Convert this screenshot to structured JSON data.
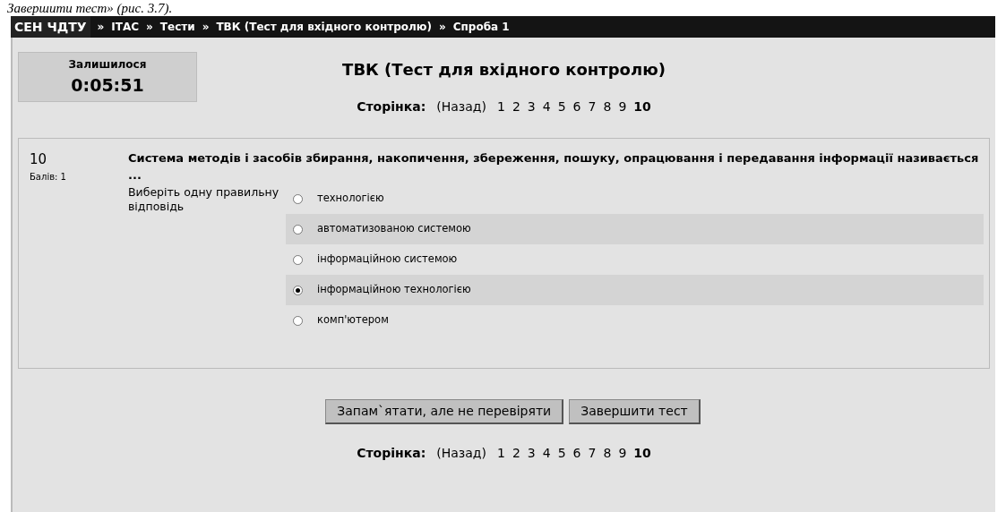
{
  "document_text": "Завершити тест» (рис. 3.7).",
  "breadcrumb": [
    {
      "label": "СЕН ЧДТУ",
      "kind": "home"
    },
    {
      "label": "ІТАС",
      "kind": "link"
    },
    {
      "label": "Тести",
      "kind": "link"
    },
    {
      "label": "ТВК (Тест для вхідного контролю)",
      "kind": "link"
    },
    {
      "label": "Спроба 1",
      "kind": "link"
    }
  ],
  "breadcrumb_separator": "»",
  "timer": {
    "label": "Залишилося",
    "value": "0:05:51"
  },
  "title": "ТВК (Тест для вхідного контролю)",
  "pager_top": {
    "label": "Сторінка:",
    "previous": "(Назад)",
    "pages": [
      {
        "label": "1",
        "selected": false
      },
      {
        "label": "2",
        "selected": false
      },
      {
        "label": "3",
        "selected": false
      },
      {
        "label": "4",
        "selected": false
      },
      {
        "label": "5",
        "selected": false
      },
      {
        "label": "6",
        "selected": false
      },
      {
        "label": "7",
        "selected": false
      },
      {
        "label": "8",
        "selected": false
      },
      {
        "label": "9",
        "selected": false
      },
      {
        "label": "10",
        "selected": true
      }
    ]
  },
  "question": {
    "number": "10",
    "grade": "Балів: 1",
    "text": "Система методів і засобів збирання, накопичення, збереження, пошуку, опрацювання і передавання інформації називається ...",
    "prompt": "Виберіть одну правильну відповідь",
    "answers": [
      {
        "label": "технологією",
        "selected": false
      },
      {
        "label": "автоматизованою системою",
        "selected": false
      },
      {
        "label": "інформаційною системою",
        "selected": false
      },
      {
        "label": "інформаційною технологією",
        "selected": true
      },
      {
        "label": "комп'ютером",
        "selected": false
      }
    ]
  },
  "buttons": [
    "Запам`ятати, але не перевіряти",
    "Завершити тест"
  ],
  "pager_bottom": {
    "label": "Сторінка:",
    "previous": "(Назад)",
    "pages": [
      {
        "label": "1",
        "selected": false
      },
      {
        "label": "2",
        "selected": false
      },
      {
        "label": "3",
        "selected": false
      },
      {
        "label": "4",
        "selected": false
      },
      {
        "label": "5",
        "selected": false
      },
      {
        "label": "6",
        "selected": false
      },
      {
        "label": "7",
        "selected": false
      },
      {
        "label": "8",
        "selected": false
      },
      {
        "label": "9",
        "selected": false
      },
      {
        "label": "10",
        "selected": true
      }
    ]
  }
}
